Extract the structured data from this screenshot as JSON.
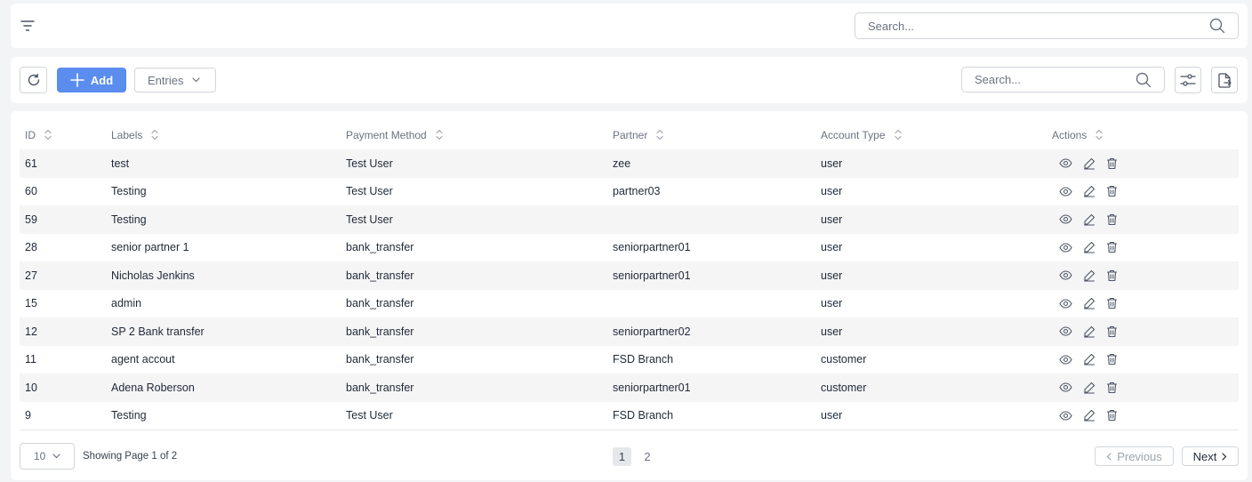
{
  "topbar": {
    "search_placeholder": "Search..."
  },
  "toolbar": {
    "add_label": "Add",
    "entries_label": "Entries",
    "search_placeholder": "Search..."
  },
  "table": {
    "columns": [
      "ID",
      "Labels",
      "Payment Method",
      "Partner",
      "Account Type",
      "Actions"
    ],
    "rows": [
      {
        "id": "61",
        "label": "test",
        "payment_method": "Test User",
        "partner": "zee",
        "account_type": "user"
      },
      {
        "id": "60",
        "label": "Testing",
        "payment_method": "Test User",
        "partner": "partner03",
        "account_type": "user"
      },
      {
        "id": "59",
        "label": "Testing",
        "payment_method": "Test User",
        "partner": "",
        "account_type": "user"
      },
      {
        "id": "28",
        "label": "senior partner 1",
        "payment_method": "bank_transfer",
        "partner": "seniorpartner01",
        "account_type": "user"
      },
      {
        "id": "27",
        "label": "Nicholas Jenkins",
        "payment_method": "bank_transfer",
        "partner": "seniorpartner01",
        "account_type": "user"
      },
      {
        "id": "15",
        "label": "admin",
        "payment_method": "bank_transfer",
        "partner": "",
        "account_type": "user"
      },
      {
        "id": "12",
        "label": "SP 2 Bank transfer",
        "payment_method": "bank_transfer",
        "partner": "seniorpartner02",
        "account_type": "user"
      },
      {
        "id": "11",
        "label": "agent accout",
        "payment_method": "bank_transfer",
        "partner": "FSD Branch",
        "account_type": "customer"
      },
      {
        "id": "10",
        "label": "Adena Roberson",
        "payment_method": "bank_transfer",
        "partner": "seniorpartner01",
        "account_type": "customer"
      },
      {
        "id": "9",
        "label": "Testing",
        "payment_method": "Test User",
        "partner": "FSD Branch",
        "account_type": "user"
      }
    ],
    "row_actions": [
      "eye-icon",
      "edit-icon",
      "trash-icon"
    ]
  },
  "pagination": {
    "page_size": "10",
    "showing_text": "Showing Page 1 of 2",
    "pages": [
      "1",
      "2"
    ],
    "current_page": "1",
    "previous_label": "Previous",
    "next_label": "Next"
  },
  "colors": {
    "accent": "#5b8def",
    "background": "#f3f4f6",
    "row_stripe": "#f5f5f6"
  }
}
